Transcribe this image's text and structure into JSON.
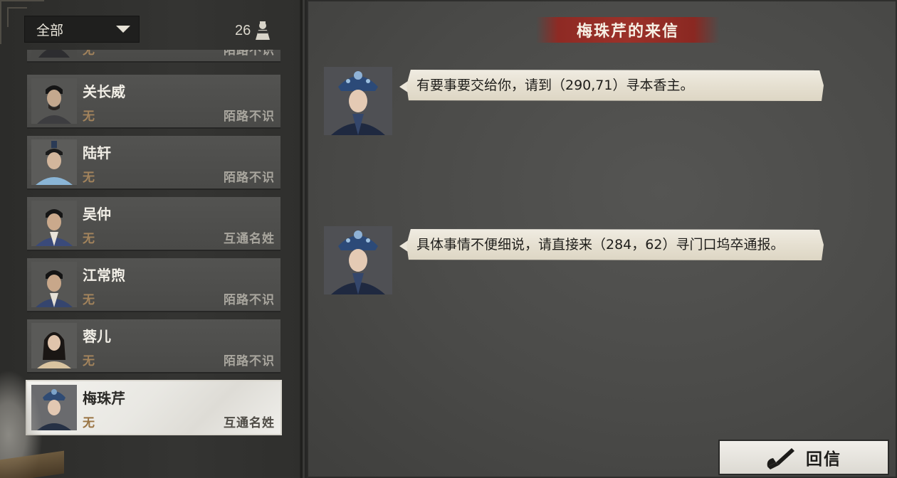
{
  "filter": {
    "selected": "全部",
    "icon": "chevron-down-icon"
  },
  "contact_count": {
    "value": "26",
    "icon": "person-icon"
  },
  "contacts": [
    {
      "name": "",
      "faction": "无",
      "relation": "陌路不识",
      "portrait": "man-portrait"
    },
    {
      "name": "关长威",
      "faction": "无",
      "relation": "陌路不识",
      "portrait": "man-portrait"
    },
    {
      "name": "陆轩",
      "faction": "无",
      "relation": "陌路不识",
      "portrait": "man-portrait"
    },
    {
      "name": "吴仲",
      "faction": "无",
      "relation": "互通名姓",
      "portrait": "man-portrait"
    },
    {
      "name": "江常煦",
      "faction": "无",
      "relation": "陌路不识",
      "portrait": "man-portrait"
    },
    {
      "name": "蓉儿",
      "faction": "无",
      "relation": "陌路不识",
      "portrait": "woman-portrait"
    },
    {
      "name": "梅珠芹",
      "faction": "无",
      "relation": "互通名姓",
      "portrait": "woman-portrait",
      "selected": true
    }
  ],
  "letter": {
    "title": "梅珠芹的来信",
    "messages": [
      {
        "text": "有要事要交给你，请到（290,71）寻本香主。",
        "avatar": "woman-portrait"
      },
      {
        "text": "具体事情不便细说，请直接来（284，62）寻门口坞卒通报。",
        "avatar": "woman-portrait"
      }
    ]
  },
  "reply_button": {
    "label": "回信",
    "icon": "brush-icon"
  },
  "colors": {
    "title_banner": "#9b3129",
    "faction_text": "#a2835c",
    "relation_text": "#a9a69e",
    "card_bg": "#4e4e4c",
    "selected_card_bg": "#eeede9",
    "bubble_bg": "#e8e2d4"
  }
}
